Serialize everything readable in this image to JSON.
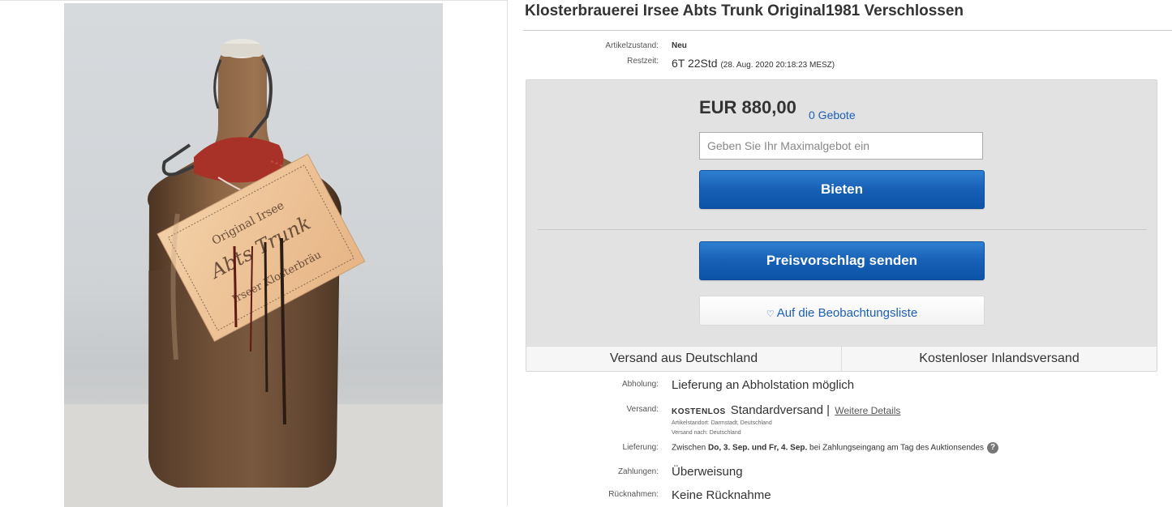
{
  "listing": {
    "title": "Klosterbrauerei Irsee Abts Trunk Original1981 Verschlossen"
  },
  "condition": {
    "label": "Artikelzustand:",
    "value": "Neu"
  },
  "time_left": {
    "label": "Restzeit:",
    "value": "6T 22Std",
    "end_date": "(28. Aug. 2020   20:18:23 MESZ)"
  },
  "bid": {
    "price": "EUR 880,00",
    "bids_count": "0 Gebote",
    "input_placeholder": "Geben Sie Ihr Maximalgebot ein",
    "bid_button": "Bieten",
    "offer_button": "Preisvorschlag senden",
    "watch_icon": "♡",
    "watch_button": "Auf die Beobachtungsliste"
  },
  "shipping_strip": {
    "left": "Versand aus Deutschland",
    "right": "Kostenloser Inlandsversand"
  },
  "pickup": {
    "label": "Abholung:",
    "value": "Lieferung an Abholstation möglich"
  },
  "shipping": {
    "label": "Versand:",
    "free": "KOSTENLOS",
    "service": "Standardversand |",
    "details_link": "Weitere Details",
    "location_line": "Artikelstandort:   Darmstadt, Deutschland",
    "ships_to_line": "Versand nach:   Deutschland"
  },
  "delivery": {
    "label": "Lieferung:",
    "prefix": "Zwischen ",
    "from": "Do, 3. Sep.",
    "and": " und ",
    "to": "Fr, 4. Sep.",
    "suffix": " bei Zahlungseingang am Tag des Auktionsendes",
    "help_icon": "?"
  },
  "payment": {
    "label": "Zahlungen:",
    "value": "Überweisung"
  },
  "returns": {
    "label": "Rücknahmen:",
    "value": "Keine Rücknahme"
  },
  "photo_tag_text": {
    "line1": "Original Irsee",
    "line2": "Abts Trunk",
    "line3": "Irseer Klosterbräu"
  },
  "colors": {
    "primary_button": "#1760b6",
    "link": "#1c5fb5",
    "bidbox_bg": "#e2e2e2"
  }
}
